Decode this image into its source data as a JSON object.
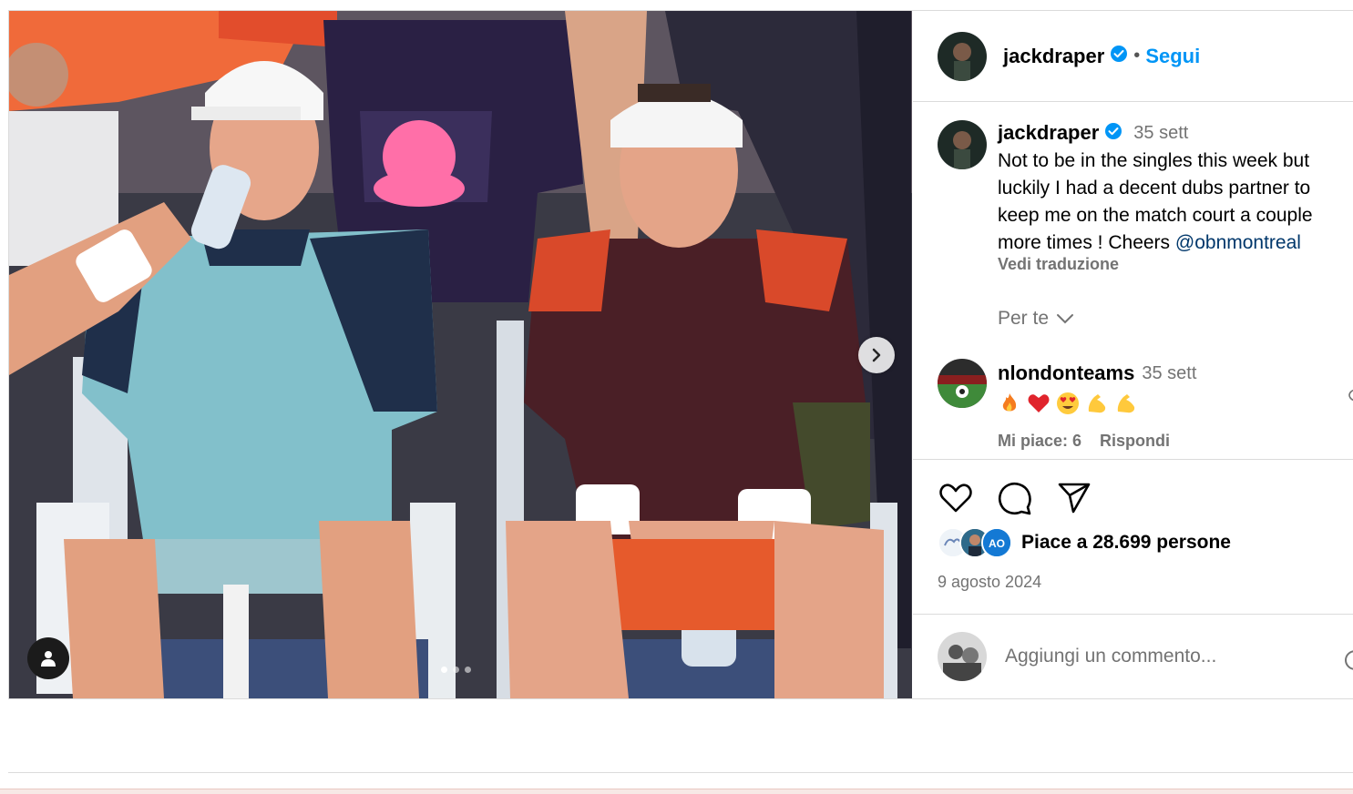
{
  "post": {
    "author": "jackdraper",
    "follow_label": "Segui",
    "separator": "•",
    "media": {
      "carousel_index": 1,
      "carousel_total": 3
    }
  },
  "caption": {
    "author": "jackdraper",
    "time": "35 sett",
    "text": "Not to be in the singles this week but luckily I had a decent dubs partner to keep me on the match court a couple more times ! Cheers ",
    "mention": "@obnmontreal",
    "translate_label": "Vedi traduzione"
  },
  "filter": {
    "label": "Per te"
  },
  "comments": [
    {
      "author": "nlondonteams",
      "time": "35 sett",
      "emojis": [
        "fire-emoji",
        "red-heart-emoji",
        "heart-eyes-emoji",
        "flexed-biceps-emoji",
        "flexed-biceps-emoji"
      ],
      "likes_label": "Mi piace: 6",
      "reply_label": "Rispondi"
    }
  ],
  "actions": {
    "icons": [
      "heart-icon",
      "comment-icon",
      "share-icon"
    ],
    "likes_text": "Piace a 28.699 persone",
    "date": "9 agosto 2024"
  },
  "add_comment": {
    "placeholder": "Aggiungi un commento..."
  },
  "colors": {
    "link_blue": "#0095f6",
    "verified_blue": "#0095f6",
    "secondary_text": "#737373",
    "border": "#dbdbdb"
  }
}
